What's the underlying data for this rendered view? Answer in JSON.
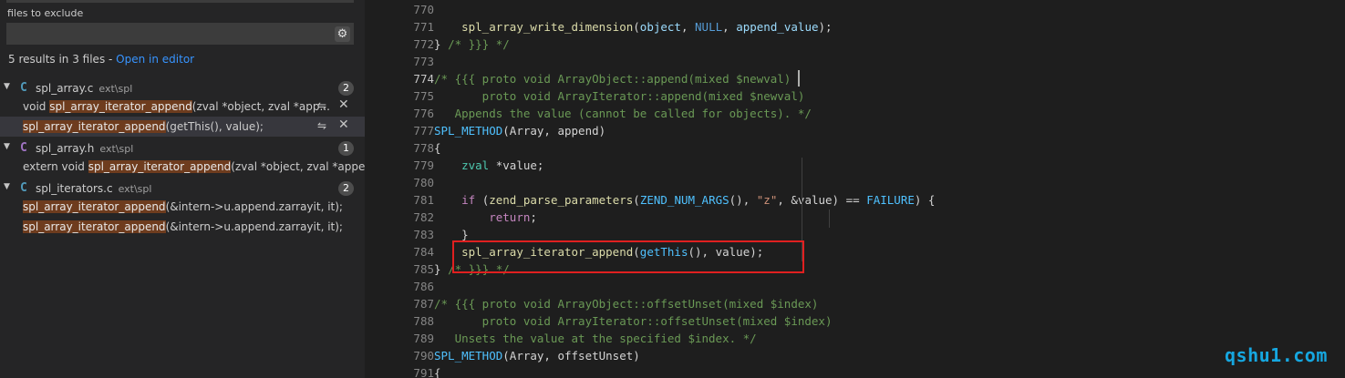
{
  "sidebar": {
    "exclude_label": "files to exclude",
    "exclude_value": "",
    "results_prefix": "5 results in 3 files - ",
    "open_in_editor": "Open in editor",
    "files": [
      {
        "icon": "C",
        "icon_color": "#519aba",
        "name": "spl_array.c",
        "path": "ext\\spl",
        "count": "2",
        "matches": [
          {
            "before": "void ",
            "highlight": "spl_array_iterator_append",
            "after": "(zval *object, zval *app..."
          },
          {
            "before": "",
            "highlight": "spl_array_iterator_append",
            "after": "(getThis(), value);"
          }
        ]
      },
      {
        "icon": "C",
        "icon_color": "#a074c4",
        "name": "spl_array.h",
        "path": "ext\\spl",
        "count": "1",
        "matches": [
          {
            "before": "extern void ",
            "highlight": "spl_array_iterator_append",
            "after": "(zval *object, zval *appen..."
          }
        ]
      },
      {
        "icon": "C",
        "icon_color": "#519aba",
        "name": "spl_iterators.c",
        "path": "ext\\spl",
        "count": "2",
        "matches": [
          {
            "before": "",
            "highlight": "spl_array_iterator_append",
            "after": "(&intern->u.append.zarrayit, it);"
          },
          {
            "before": "",
            "highlight": "spl_array_iterator_append",
            "after": "(&intern->u.append.zarrayit, it);"
          }
        ]
      }
    ]
  },
  "editor": {
    "current_line": 774,
    "lines": [
      {
        "n": "770",
        "t": []
      },
      {
        "n": "771",
        "t": [
          [
            "",
            "    "
          ],
          [
            "f",
            "spl_array_write_dimension"
          ],
          [
            "",
            "("
          ],
          [
            "v",
            "object"
          ],
          [
            "",
            ", "
          ],
          [
            "k",
            "NULL"
          ],
          [
            "",
            ", "
          ],
          [
            "v",
            "append_value"
          ],
          [
            "",
            ");"
          ]
        ]
      },
      {
        "n": "772",
        "t": [
          [
            "",
            "} "
          ],
          [
            "c",
            "/* }}} */"
          ]
        ]
      },
      {
        "n": "773",
        "t": []
      },
      {
        "n": "774",
        "t": [
          [
            "c",
            "/* {{{ proto void ArrayObject::append(mixed $newval)"
          ]
        ]
      },
      {
        "n": "775",
        "t": [
          [
            "c",
            "       proto void ArrayIterator::append(mixed $newval)"
          ]
        ]
      },
      {
        "n": "776",
        "t": [
          [
            "c",
            "   Appends the value (cannot be called for objects). */"
          ]
        ]
      },
      {
        "n": "777",
        "t": [
          [
            "m",
            "SPL_METHOD"
          ],
          [
            "",
            "(Array, append)"
          ]
        ]
      },
      {
        "n": "778",
        "t": [
          [
            "",
            "{"
          ]
        ]
      },
      {
        "n": "779",
        "t": [
          [
            "",
            "    "
          ],
          [
            "t",
            "zval"
          ],
          [
            "",
            " *value;"
          ]
        ]
      },
      {
        "n": "780",
        "t": []
      },
      {
        "n": "781",
        "t": [
          [
            "",
            "    "
          ],
          [
            "kc",
            "if"
          ],
          [
            "",
            " ("
          ],
          [
            "f",
            "zend_parse_parameters"
          ],
          [
            "",
            "("
          ],
          [
            "m",
            "ZEND_NUM_ARGS"
          ],
          [
            "",
            "(), "
          ],
          [
            "s",
            "\"z\""
          ],
          [
            "",
            ", &value) == "
          ],
          [
            "m",
            "FAILURE"
          ],
          [
            "",
            ") {"
          ]
        ]
      },
      {
        "n": "782",
        "t": [
          [
            "",
            "        "
          ],
          [
            "kc",
            "return"
          ],
          [
            "",
            ";"
          ]
        ]
      },
      {
        "n": "783",
        "t": [
          [
            "",
            "    }"
          ]
        ]
      },
      {
        "n": "784",
        "t": [
          [
            "",
            "    "
          ],
          [
            "f",
            "spl_array_iterator_append"
          ],
          [
            "",
            "("
          ],
          [
            "m",
            "getThis"
          ],
          [
            "",
            "(), value);"
          ]
        ]
      },
      {
        "n": "785",
        "t": [
          [
            "",
            "} "
          ],
          [
            "c",
            "/* }}} */"
          ]
        ]
      },
      {
        "n": "786",
        "t": []
      },
      {
        "n": "787",
        "t": [
          [
            "c",
            "/* {{{ proto void ArrayObject::offsetUnset(mixed $index)"
          ]
        ]
      },
      {
        "n": "788",
        "t": [
          [
            "c",
            "       proto void ArrayIterator::offsetUnset(mixed $index)"
          ]
        ]
      },
      {
        "n": "789",
        "t": [
          [
            "c",
            "   Unsets the value at the specified $index. */"
          ]
        ]
      },
      {
        "n": "790",
        "t": [
          [
            "m",
            "SPL_METHOD"
          ],
          [
            "",
            "(Array, offsetUnset)"
          ]
        ]
      },
      {
        "n": "791",
        "t": [
          [
            "",
            "{"
          ]
        ]
      }
    ]
  },
  "watermark": "qshu1.com"
}
